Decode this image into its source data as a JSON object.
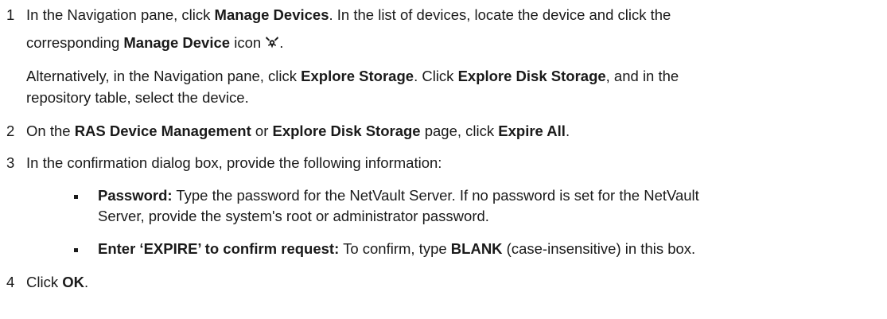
{
  "steps": [
    {
      "number": "1",
      "line1_pre": "In the Navigation pane, click ",
      "line1_b1": "Manage Devices",
      "line1_post": ". In the list of devices, locate the device and click the",
      "line2_pre": "corresponding ",
      "line2_b1": "Manage Device",
      "line2_post": " icon",
      "line2_end": ".",
      "icon": "manage-device-icon",
      "alt1_pre": "Alternatively, in the Navigation pane, click ",
      "alt1_b1": "Explore Storage",
      "alt1_mid": ". Click ",
      "alt1_b2": "Explore Disk Storage",
      "alt1_post": ", and in the",
      "alt2": "repository table, select the device."
    },
    {
      "number": "2",
      "pre": "On the ",
      "b1": "RAS Device Management",
      "mid": " or ",
      "b2": "Explore Disk Storage",
      "mid2": " page, click ",
      "b3": "Expire All",
      "post": "."
    },
    {
      "number": "3",
      "text": "In the confirmation dialog box, provide the following information:",
      "bullets": [
        {
          "label": "Password:",
          "line1": " Type the password for the NetVault Server. If no password is set for the NetVault",
          "line2": "Server, provide the system's root or administrator password."
        },
        {
          "label": "Enter ‘EXPIRE’ to confirm request:",
          "pre": " To confirm, type ",
          "b": "BLANK",
          "post": " (case-insensitive) in this box."
        }
      ]
    },
    {
      "number": "4",
      "pre": "Click ",
      "b": "OK",
      "post": "."
    }
  ]
}
